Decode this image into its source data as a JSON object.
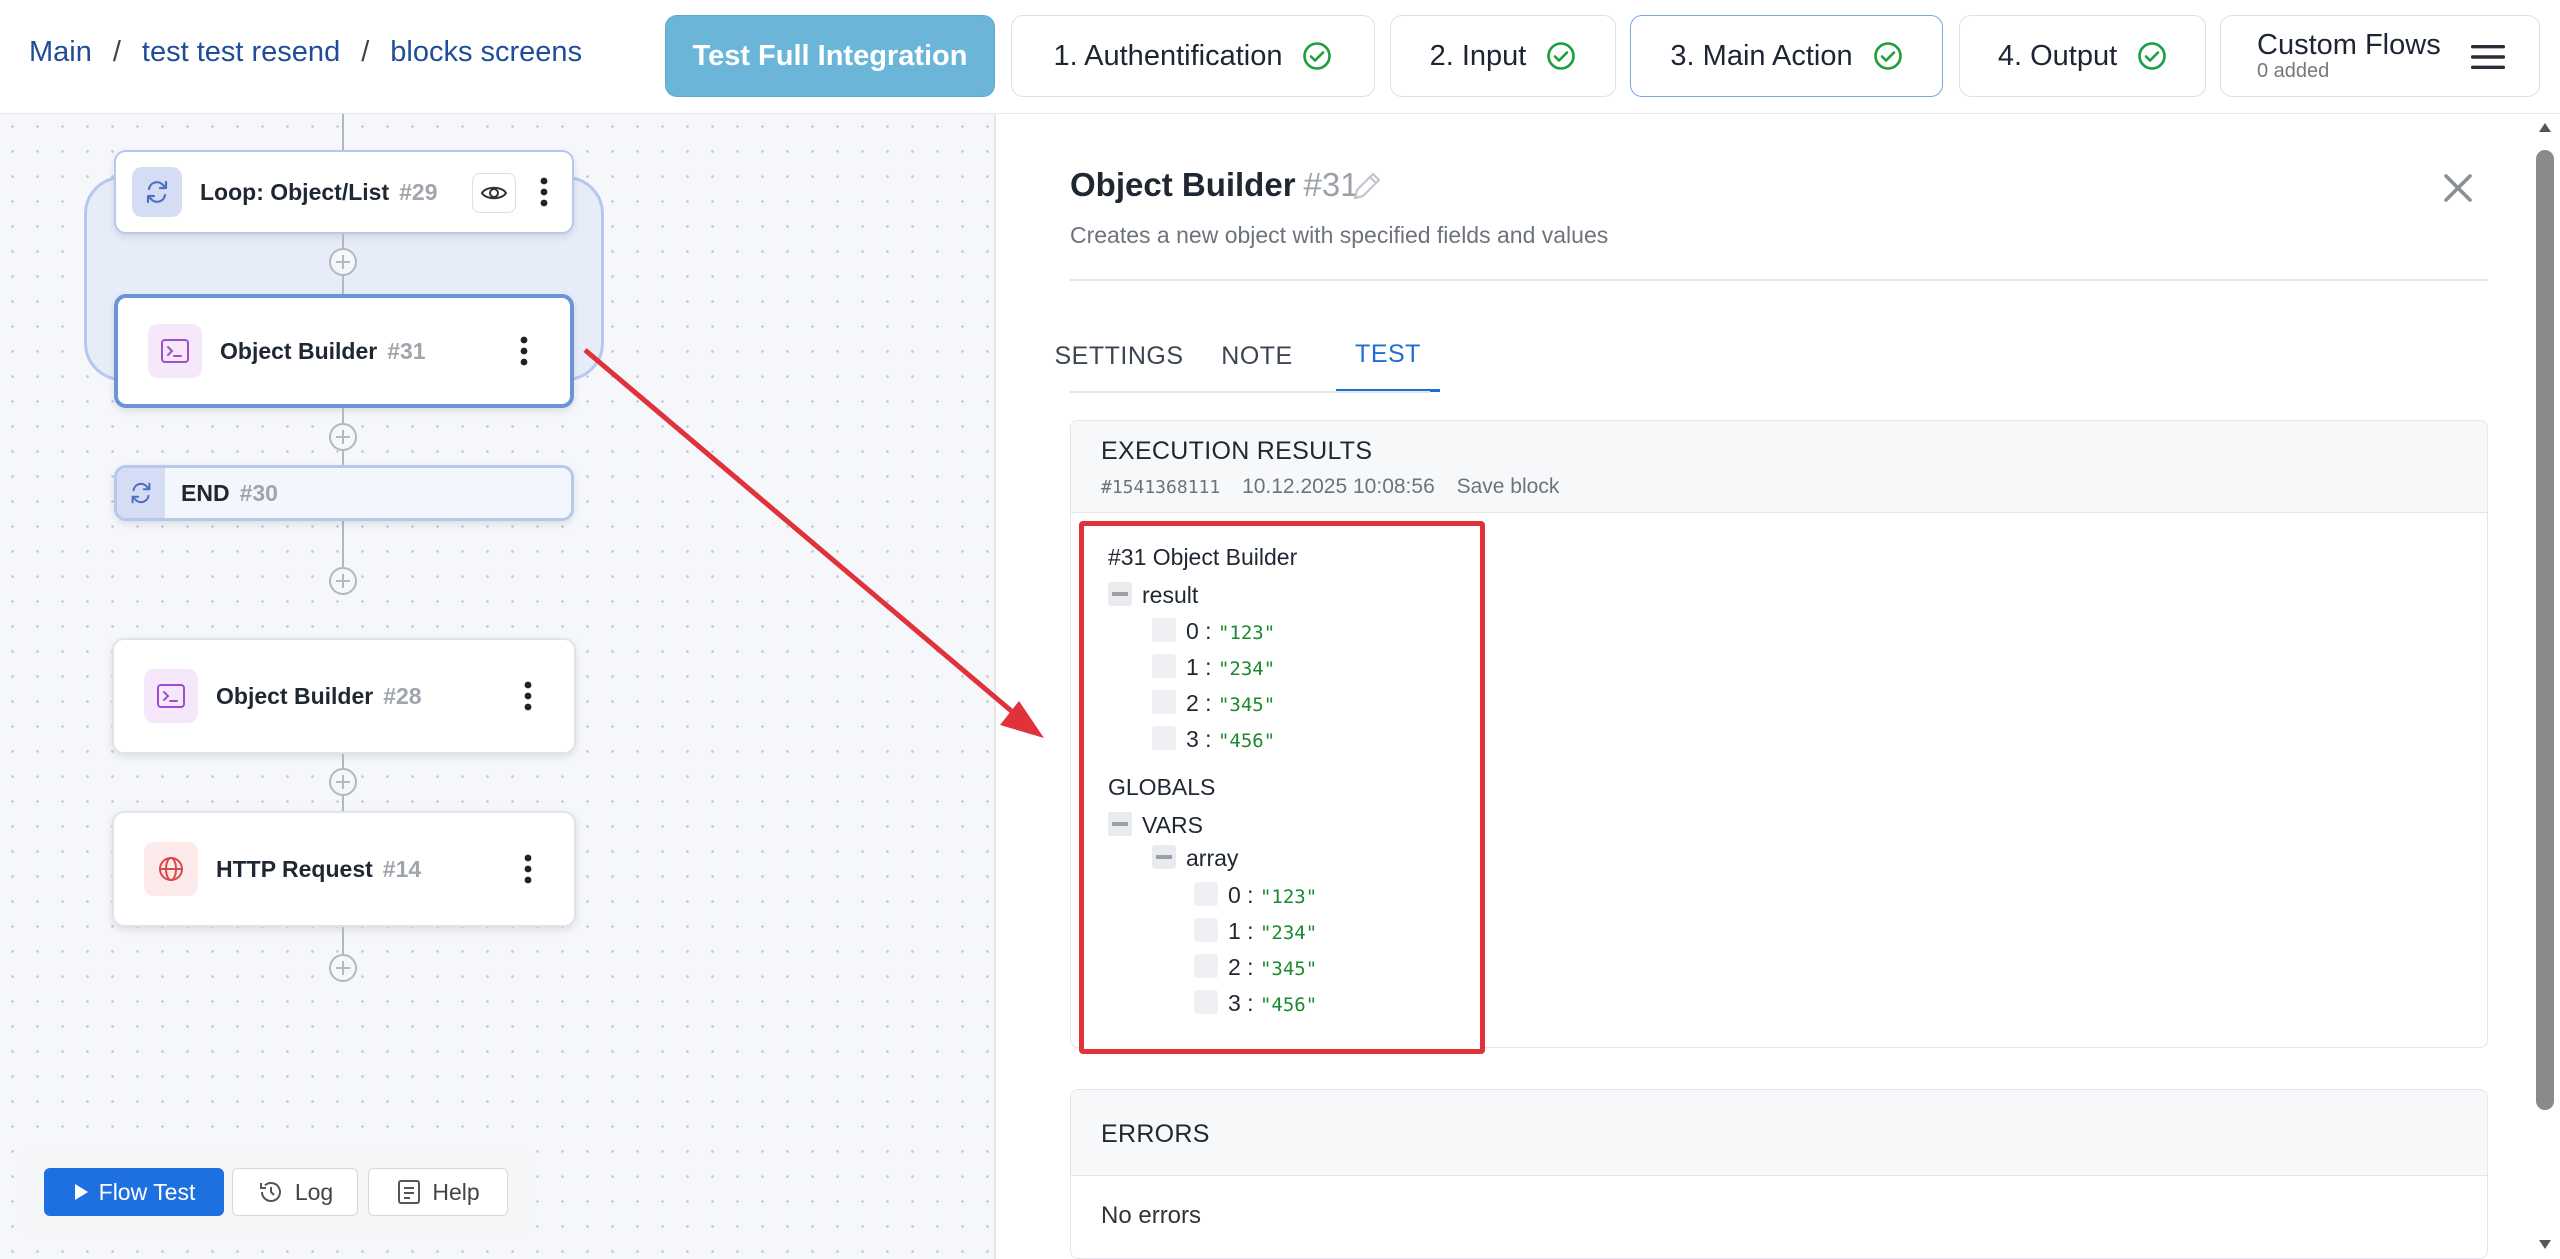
{
  "breadcrumb": [
    "Main",
    "test test resend",
    "blocks screens"
  ],
  "nav_tabs": {
    "full_test": "Test Full Integration",
    "auth": "1. Authentification",
    "input": "2. Input",
    "main_action": "3. Main Action",
    "output": "4. Output",
    "custom_flows": "Custom Flows",
    "custom_flows_sub": "0 added"
  },
  "canvas": {
    "nodes": [
      {
        "label": "Loop: Object/List",
        "num": "#29",
        "icon": "loop-icon"
      },
      {
        "label": "Object Builder",
        "num": "#31",
        "icon": "terminal-icon"
      },
      {
        "label": "END",
        "num": "#30",
        "icon": "loop-icon"
      },
      {
        "label": "Object Builder",
        "num": "#28",
        "icon": "terminal-icon"
      },
      {
        "label": "HTTP Request",
        "num": "#14",
        "icon": "globe-icon"
      }
    ]
  },
  "toolbar": {
    "flow_test": "Flow Test",
    "log": "Log",
    "help": "Help"
  },
  "panel": {
    "title": "Object Builder",
    "title_num": "#31",
    "description": "Creates a new object with specified fields and values",
    "tabs": [
      "SETTINGS",
      "NOTE",
      "TEST"
    ],
    "active_tab": "TEST",
    "exec": {
      "title": "EXECUTION RESULTS",
      "id": "#1541368111",
      "datetime": "10.12.2025 10:08:56",
      "save_label": "Save block"
    },
    "tree": {
      "header": "#31 Object Builder",
      "result_key": "result",
      "result_items": [
        {
          "k": "0",
          "v": "\"123\""
        },
        {
          "k": "1",
          "v": "\"234\""
        },
        {
          "k": "2",
          "v": "\"345\""
        },
        {
          "k": "3",
          "v": "\"456\""
        }
      ],
      "globals_header": "GLOBALS",
      "vars_key": "VARS",
      "array_key": "array",
      "array_items": [
        {
          "k": "0",
          "v": "\"123\""
        },
        {
          "k": "1",
          "v": "\"234\""
        },
        {
          "k": "2",
          "v": "\"345\""
        },
        {
          "k": "3",
          "v": "\"456\""
        }
      ]
    },
    "errors_title": "ERRORS",
    "errors_text": "No errors"
  },
  "colors": {
    "accent": "#1f6fd1",
    "highlight": "#e0323a",
    "success": "#1e9e3a"
  }
}
